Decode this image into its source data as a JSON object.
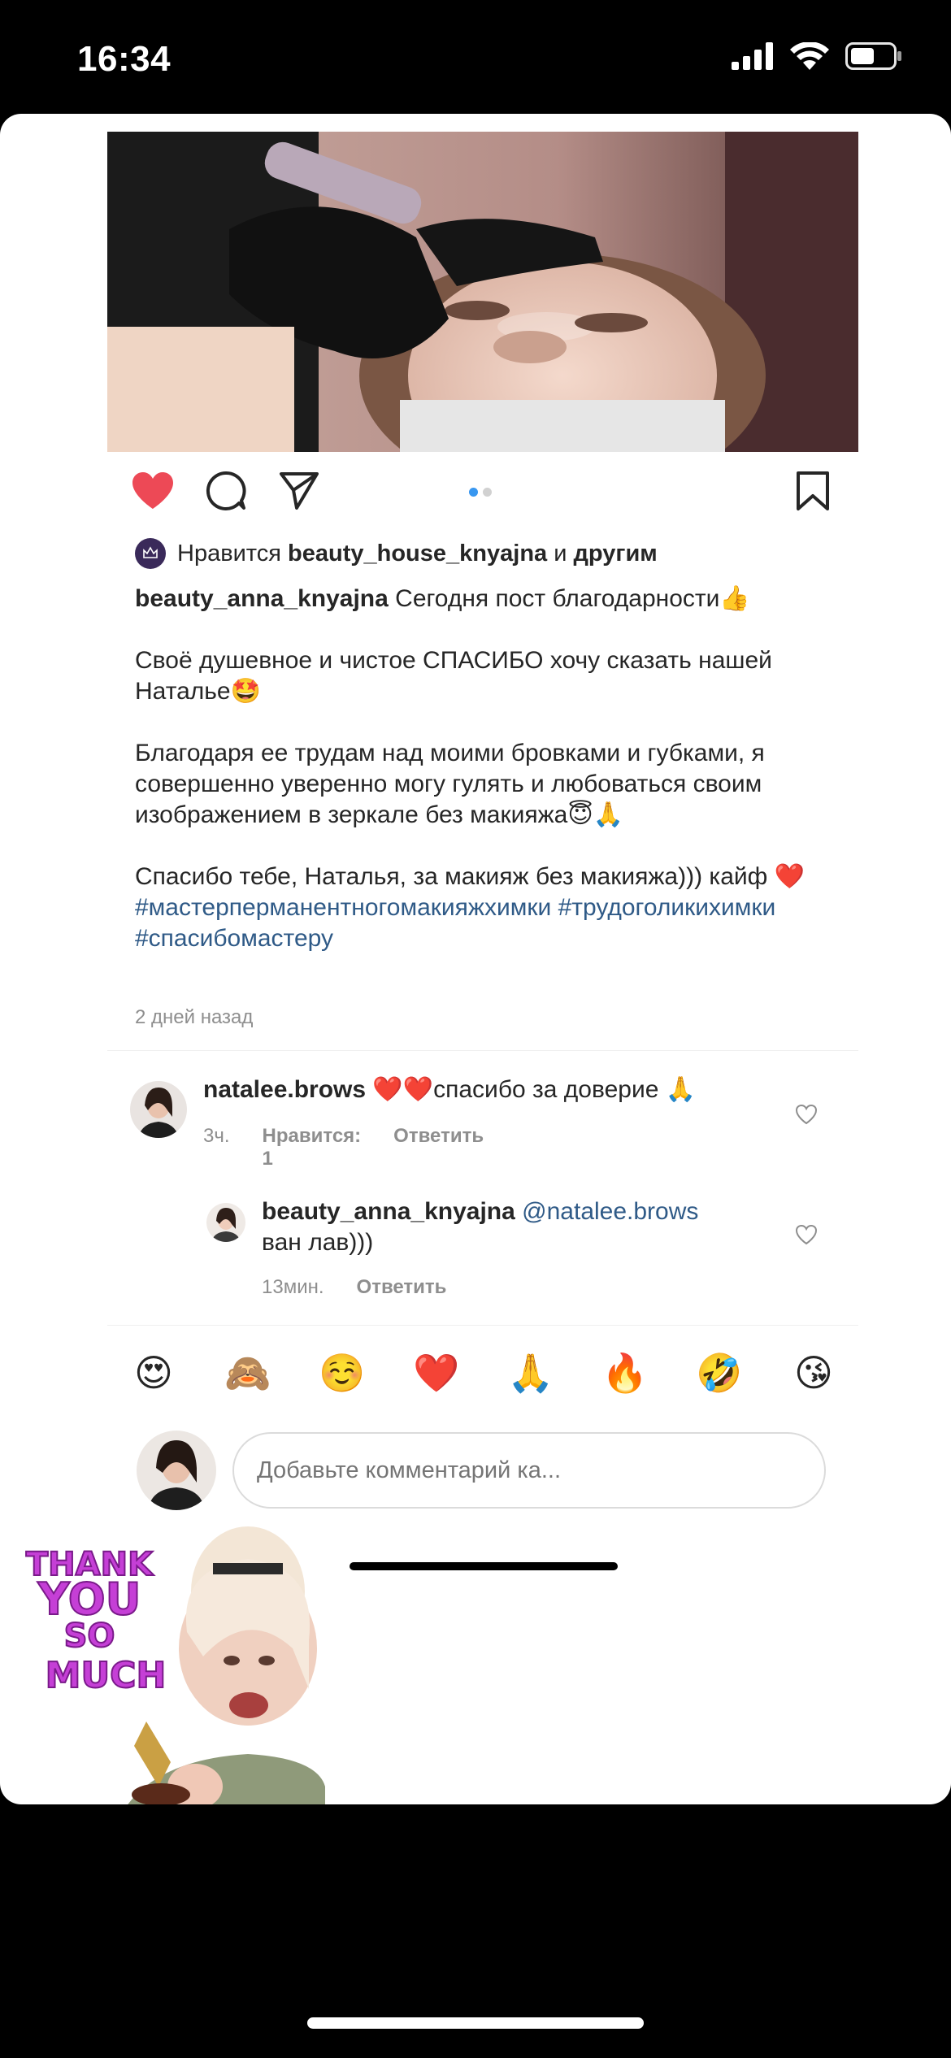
{
  "status_bar": {
    "time": "16:34"
  },
  "post": {
    "likes": {
      "prefix": "Нравится",
      "user": "beauty_house_knyajna",
      "suffix": "и",
      "others": "другим"
    },
    "caption": {
      "username": "beauty_anna_knyajna",
      "line1": "Сегодня пост благодарности👍",
      "para2": "Своё душевное и чистое СПАСИБО хочу сказать нашей Наталье🤩",
      "para3": "Благодаря ее трудам над моими бровками и губками, я совершенно уверенно могу гулять и любоваться своим изображением в зеркале без макияжа😇🙏",
      "para4": "Спасибо тебе, Наталья, за макияж без макияжа))) кайф ❤️",
      "hashtags": "#мастерперманентногомакияжхимки #трудоголикихимки #спасибомастеру"
    },
    "time_ago": "2 дней назад"
  },
  "comments": [
    {
      "username": "natalee.brows",
      "text": "❤️❤️спасибо за доверие 🙏",
      "time": "3ч.",
      "likes": "Нравится: 1",
      "reply": "Ответить"
    },
    {
      "username": "beauty_anna_knyajna",
      "mention": "@natalee.brows",
      "text": "ван лав)))",
      "time": "13мин.",
      "reply": "Ответить"
    }
  ],
  "emoji_bar": [
    "😍",
    "🙈",
    "☺️",
    "❤️",
    "🙏",
    "🔥",
    "🤣",
    "😘"
  ],
  "add_comment": {
    "placeholder": "Добавьте комментарий ка..."
  },
  "sticker": {
    "line1": "THANK",
    "line2": "YOU",
    "line3": "SO",
    "line4": "MUCH"
  },
  "colors": {
    "like_red": "#ed4956",
    "link_blue": "#2f5a87",
    "dot_active": "#3897f0",
    "meta_grey": "#8e8e8e"
  }
}
